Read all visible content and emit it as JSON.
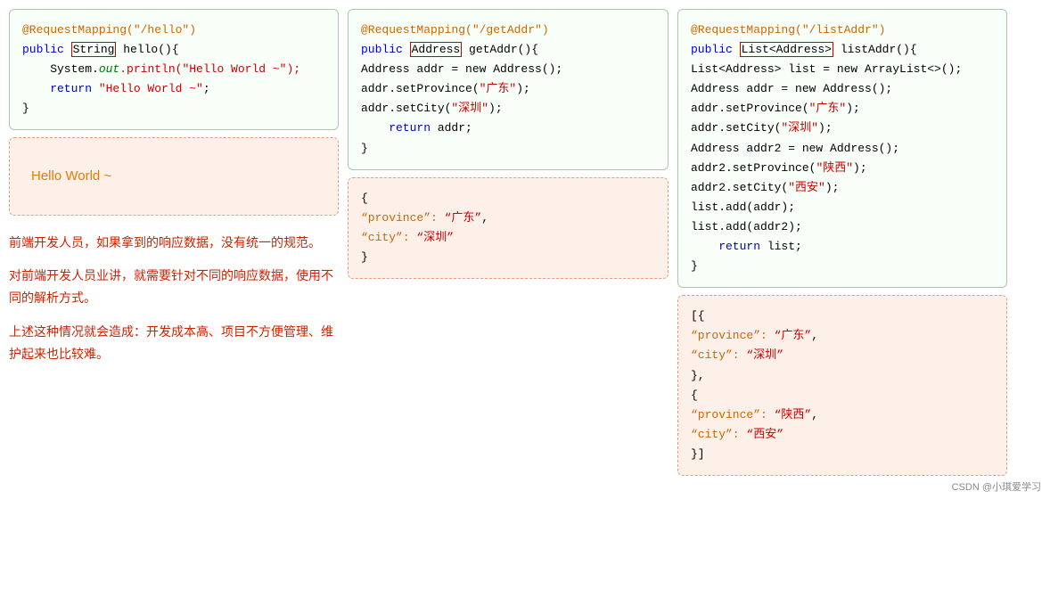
{
  "col1": {
    "code": {
      "annotation": "@RequestMapping(\"/hello\")",
      "line1": "public ",
      "type1": "String",
      "line1b": " hello(){",
      "line2": "    System.",
      "out": "out",
      "line2b": ".println(\"Hello World ~\");",
      "line3": "    return \"Hello World ~\";",
      "line4": "}"
    },
    "result": {
      "text": "Hello World ~"
    },
    "info": [
      "前端开发人员，如果拿到的响应数据，没有统一的规范。",
      "对前端开发人员业讲，就需要针对不同的响应数据，使用不同的解析方式。",
      "上述这种情况就会造成：开发成本高、项目不方便管理、维护起来也比较难。"
    ]
  },
  "col2": {
    "code": {
      "annotation": "@RequestMapping(\"/getAddr\")",
      "line1": "public ",
      "type1": "Address",
      "line1b": " getAddr(){",
      "line2": "    Address addr = new Address();",
      "line3a": "    addr.setProvince(",
      "line3b": "\"广东\"",
      "line3c": ");",
      "line4a": "    addr.setCity(",
      "line4b": "\"深圳\"",
      "line4c": ");",
      "line5": "    return addr;",
      "line6": "}"
    },
    "result": {
      "line1": "{",
      "line2a": "    “province”: ",
      "line2b": "“广东”",
      "line2c": ",",
      "line3a": "    “city”: ",
      "line3b": "“深圳”",
      "line4": "}"
    }
  },
  "col3": {
    "code": {
      "annotation": "@RequestMapping(\"/listAddr\")",
      "line1": "public ",
      "type1": "List<Address>",
      "line1b": " listAddr(){",
      "line2": "    List<Address> list = new ArrayList<>();",
      "line3": "    Address addr = new Address();",
      "line4a": "    addr.setProvince(",
      "line4b": "\"广东\"",
      "line4c": ");",
      "line5a": "    addr.setCity(",
      "line5b": "\"深圳\"",
      "line5c": ");",
      "line6": "    Address addr2 = new Address();",
      "line7a": "    addr2.setProvince(",
      "line7b": "\"陕西\"",
      "line7c": ");",
      "line8a": "    addr2.setCity(",
      "line8b": "\"西安\"",
      "line8c": ");",
      "line9": "    list.add(addr);",
      "line10": "    list.add(addr2);",
      "line11": "    return list;",
      "line12": "}"
    },
    "result": {
      "line1": "[{",
      "line2a": "        “province”: ",
      "line2b": "“广东”",
      "line2c": ",",
      "line3a": "        “city”: ",
      "line3b": "“深圳”",
      "line4": "    },",
      "line5": "    {",
      "line6a": "        “province”: ",
      "line6b": "“陕西”",
      "line6c": ",",
      "line7a": "        “city”: ",
      "line7b": "“西安”",
      "line8": "    }]"
    }
  },
  "watermark": "CSDN @小琪爱学习"
}
